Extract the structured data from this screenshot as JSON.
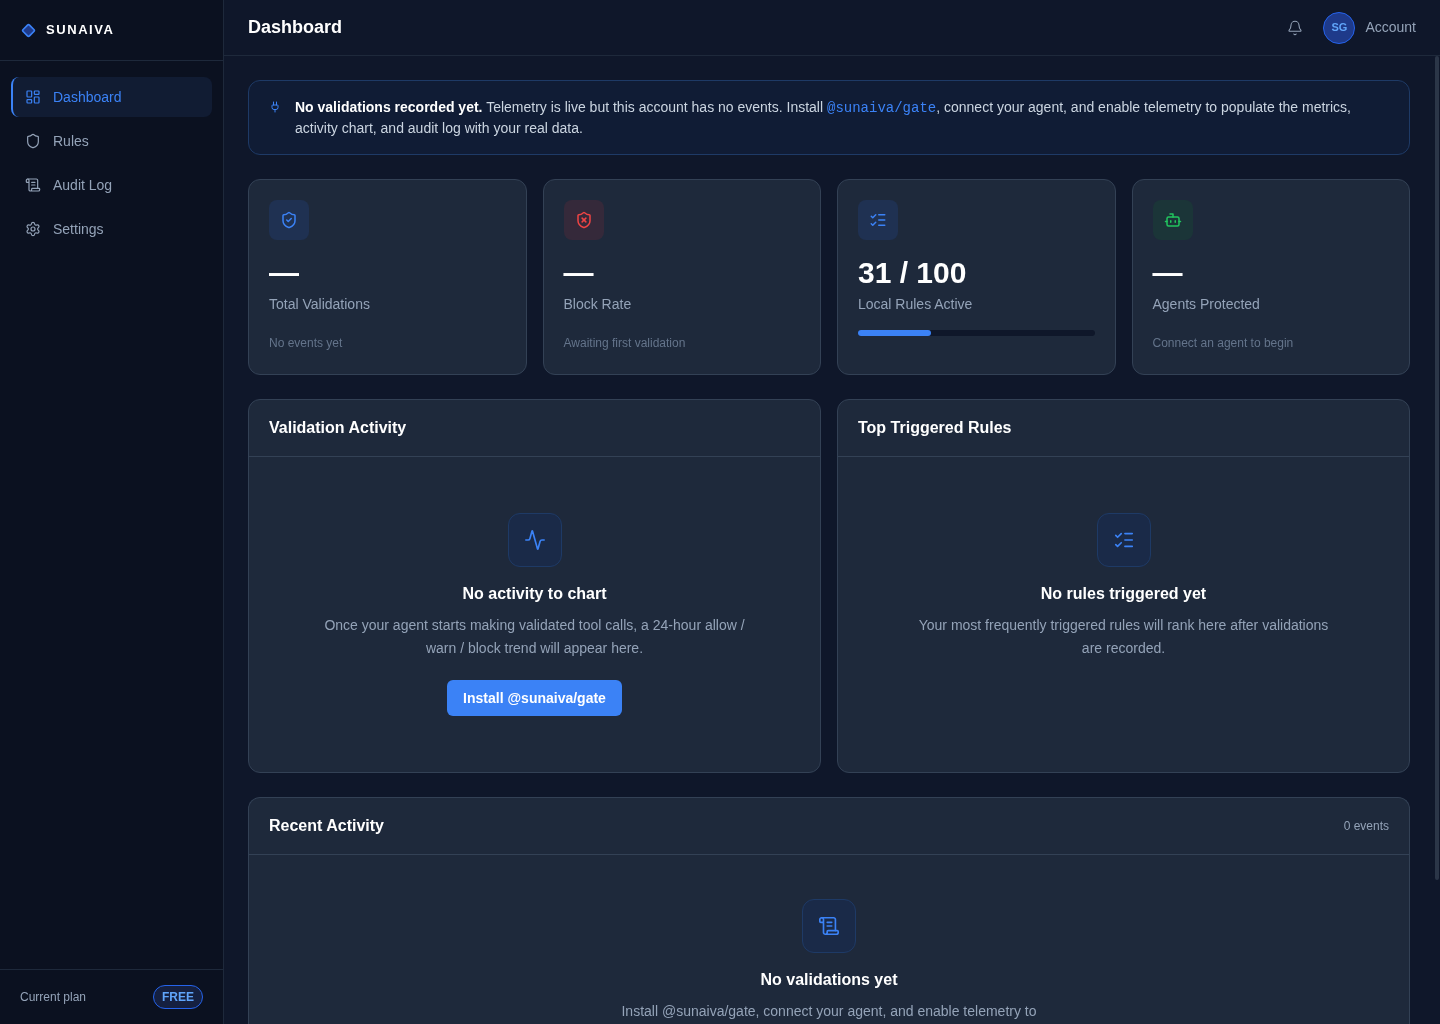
{
  "sidebar": {
    "brand": "SUNAIVA",
    "nav": [
      {
        "label": "Dashboard",
        "selected": true
      },
      {
        "label": "Rules",
        "selected": false
      },
      {
        "label": "Audit Log",
        "selected": false
      },
      {
        "label": "Settings",
        "selected": false
      }
    ],
    "footer": {
      "label": "Current plan",
      "badge": "FREE"
    }
  },
  "header": {
    "title": "Dashboard",
    "avatar_initials": "SG",
    "account": "Account"
  },
  "banner": {
    "title": "No validations recorded yet.",
    "text_before": "Telemetry is live but this account has no events. Install",
    "code": "@sunaiva/gate",
    "text_after": ", connect your agent, and enable telemetry to populate the metrics, activity chart, and audit log with your real data."
  },
  "stats": [
    {
      "kind": "count",
      "value": "—",
      "label": "Total Validations",
      "note": "No events yet"
    },
    {
      "kind": "count",
      "value": "—",
      "label": "Block Rate",
      "note": "Awaiting first validation"
    },
    {
      "kind": "progress",
      "value": "31 / 100",
      "label": "Local Rules Active",
      "level": 0.31
    },
    {
      "kind": "count",
      "value": "—",
      "label": "Agents Protected",
      "note": "Connect an agent to begin"
    }
  ],
  "panels": [
    {
      "title": "Validation Activity",
      "empty": {
        "title": "No activity to chart",
        "text": "Once your agent starts making validated tool calls, a 24-hour allow / warn / block trend will appear here.",
        "button": "Install @sunaiva/gate"
      }
    },
    {
      "title": "Top Triggered Rules",
      "empty": {
        "title": "No rules triggered yet",
        "text": "Your most frequently triggered rules will rank here after validations are recorded."
      }
    }
  ],
  "recent_activity": {
    "title": "Recent Activity",
    "count": "0 events",
    "empty": {
      "title": "No validations yet",
      "text": "Install @sunaiva/gate, connect your agent, and enable telemetry to"
    }
  }
}
